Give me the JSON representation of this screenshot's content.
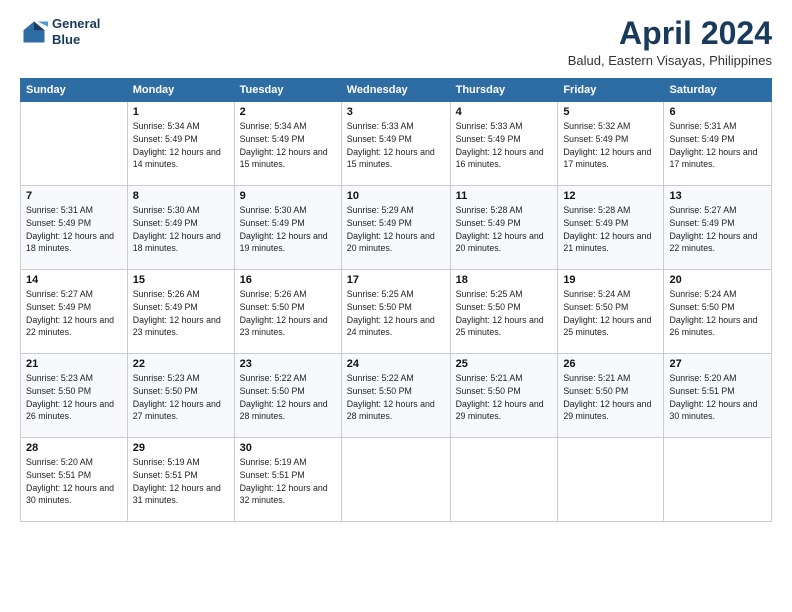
{
  "header": {
    "logo_line1": "General",
    "logo_line2": "Blue",
    "month_title": "April 2024",
    "subtitle": "Balud, Eastern Visayas, Philippines"
  },
  "days_of_week": [
    "Sunday",
    "Monday",
    "Tuesday",
    "Wednesday",
    "Thursday",
    "Friday",
    "Saturday"
  ],
  "weeks": [
    [
      {
        "day": "",
        "info": ""
      },
      {
        "day": "1",
        "info": "Sunrise: 5:34 AM\nSunset: 5:49 PM\nDaylight: 12 hours\nand 14 minutes."
      },
      {
        "day": "2",
        "info": "Sunrise: 5:34 AM\nSunset: 5:49 PM\nDaylight: 12 hours\nand 15 minutes."
      },
      {
        "day": "3",
        "info": "Sunrise: 5:33 AM\nSunset: 5:49 PM\nDaylight: 12 hours\nand 15 minutes."
      },
      {
        "day": "4",
        "info": "Sunrise: 5:33 AM\nSunset: 5:49 PM\nDaylight: 12 hours\nand 16 minutes."
      },
      {
        "day": "5",
        "info": "Sunrise: 5:32 AM\nSunset: 5:49 PM\nDaylight: 12 hours\nand 17 minutes."
      },
      {
        "day": "6",
        "info": "Sunrise: 5:31 AM\nSunset: 5:49 PM\nDaylight: 12 hours\nand 17 minutes."
      }
    ],
    [
      {
        "day": "7",
        "info": "Sunrise: 5:31 AM\nSunset: 5:49 PM\nDaylight: 12 hours\nand 18 minutes."
      },
      {
        "day": "8",
        "info": "Sunrise: 5:30 AM\nSunset: 5:49 PM\nDaylight: 12 hours\nand 18 minutes."
      },
      {
        "day": "9",
        "info": "Sunrise: 5:30 AM\nSunset: 5:49 PM\nDaylight: 12 hours\nand 19 minutes."
      },
      {
        "day": "10",
        "info": "Sunrise: 5:29 AM\nSunset: 5:49 PM\nDaylight: 12 hours\nand 20 minutes."
      },
      {
        "day": "11",
        "info": "Sunrise: 5:28 AM\nSunset: 5:49 PM\nDaylight: 12 hours\nand 20 minutes."
      },
      {
        "day": "12",
        "info": "Sunrise: 5:28 AM\nSunset: 5:49 PM\nDaylight: 12 hours\nand 21 minutes."
      },
      {
        "day": "13",
        "info": "Sunrise: 5:27 AM\nSunset: 5:49 PM\nDaylight: 12 hours\nand 22 minutes."
      }
    ],
    [
      {
        "day": "14",
        "info": "Sunrise: 5:27 AM\nSunset: 5:49 PM\nDaylight: 12 hours\nand 22 minutes."
      },
      {
        "day": "15",
        "info": "Sunrise: 5:26 AM\nSunset: 5:49 PM\nDaylight: 12 hours\nand 23 minutes."
      },
      {
        "day": "16",
        "info": "Sunrise: 5:26 AM\nSunset: 5:50 PM\nDaylight: 12 hours\nand 23 minutes."
      },
      {
        "day": "17",
        "info": "Sunrise: 5:25 AM\nSunset: 5:50 PM\nDaylight: 12 hours\nand 24 minutes."
      },
      {
        "day": "18",
        "info": "Sunrise: 5:25 AM\nSunset: 5:50 PM\nDaylight: 12 hours\nand 25 minutes."
      },
      {
        "day": "19",
        "info": "Sunrise: 5:24 AM\nSunset: 5:50 PM\nDaylight: 12 hours\nand 25 minutes."
      },
      {
        "day": "20",
        "info": "Sunrise: 5:24 AM\nSunset: 5:50 PM\nDaylight: 12 hours\nand 26 minutes."
      }
    ],
    [
      {
        "day": "21",
        "info": "Sunrise: 5:23 AM\nSunset: 5:50 PM\nDaylight: 12 hours\nand 26 minutes."
      },
      {
        "day": "22",
        "info": "Sunrise: 5:23 AM\nSunset: 5:50 PM\nDaylight: 12 hours\nand 27 minutes."
      },
      {
        "day": "23",
        "info": "Sunrise: 5:22 AM\nSunset: 5:50 PM\nDaylight: 12 hours\nand 28 minutes."
      },
      {
        "day": "24",
        "info": "Sunrise: 5:22 AM\nSunset: 5:50 PM\nDaylight: 12 hours\nand 28 minutes."
      },
      {
        "day": "25",
        "info": "Sunrise: 5:21 AM\nSunset: 5:50 PM\nDaylight: 12 hours\nand 29 minutes."
      },
      {
        "day": "26",
        "info": "Sunrise: 5:21 AM\nSunset: 5:50 PM\nDaylight: 12 hours\nand 29 minutes."
      },
      {
        "day": "27",
        "info": "Sunrise: 5:20 AM\nSunset: 5:51 PM\nDaylight: 12 hours\nand 30 minutes."
      }
    ],
    [
      {
        "day": "28",
        "info": "Sunrise: 5:20 AM\nSunset: 5:51 PM\nDaylight: 12 hours\nand 30 minutes."
      },
      {
        "day": "29",
        "info": "Sunrise: 5:19 AM\nSunset: 5:51 PM\nDaylight: 12 hours\nand 31 minutes."
      },
      {
        "day": "30",
        "info": "Sunrise: 5:19 AM\nSunset: 5:51 PM\nDaylight: 12 hours\nand 32 minutes."
      },
      {
        "day": "",
        "info": ""
      },
      {
        "day": "",
        "info": ""
      },
      {
        "day": "",
        "info": ""
      },
      {
        "day": "",
        "info": ""
      }
    ]
  ]
}
